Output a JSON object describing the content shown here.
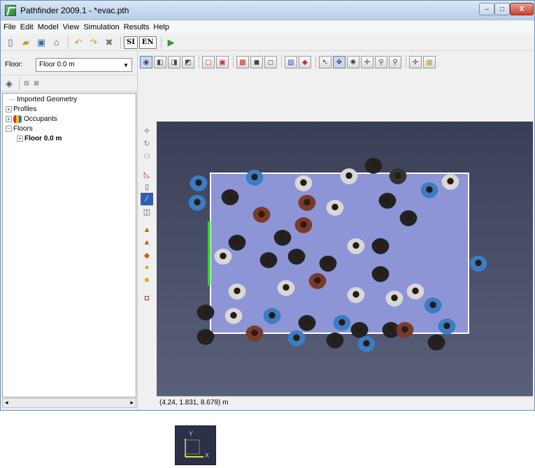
{
  "window": {
    "title": "Pathfinder 2009.1 - *evac.pth",
    "min_glyph": "–",
    "max_glyph": "□",
    "close_glyph": "X"
  },
  "menu": [
    "File",
    "Edit",
    "Model",
    "View",
    "Simulation",
    "Results",
    "Help"
  ],
  "toolbar": {
    "si": "SI",
    "en": "EN"
  },
  "floor_selector": {
    "label": "Floor:",
    "value": "Floor 0.0 m"
  },
  "tree": {
    "items": [
      {
        "label": "Imported Geometry"
      },
      {
        "label": "Profiles"
      },
      {
        "label": "Occupants"
      },
      {
        "label": "Floors"
      },
      {
        "label": "Floor 0.0 m"
      }
    ]
  },
  "axis": {
    "y": "Y",
    "x": "X"
  },
  "status": {
    "coords": "(4.24, 1.831, 8.679) m"
  },
  "colors": {
    "floor": "#8d95d6",
    "exit": "#39d139",
    "viewport_bg": "#4a4f68"
  }
}
